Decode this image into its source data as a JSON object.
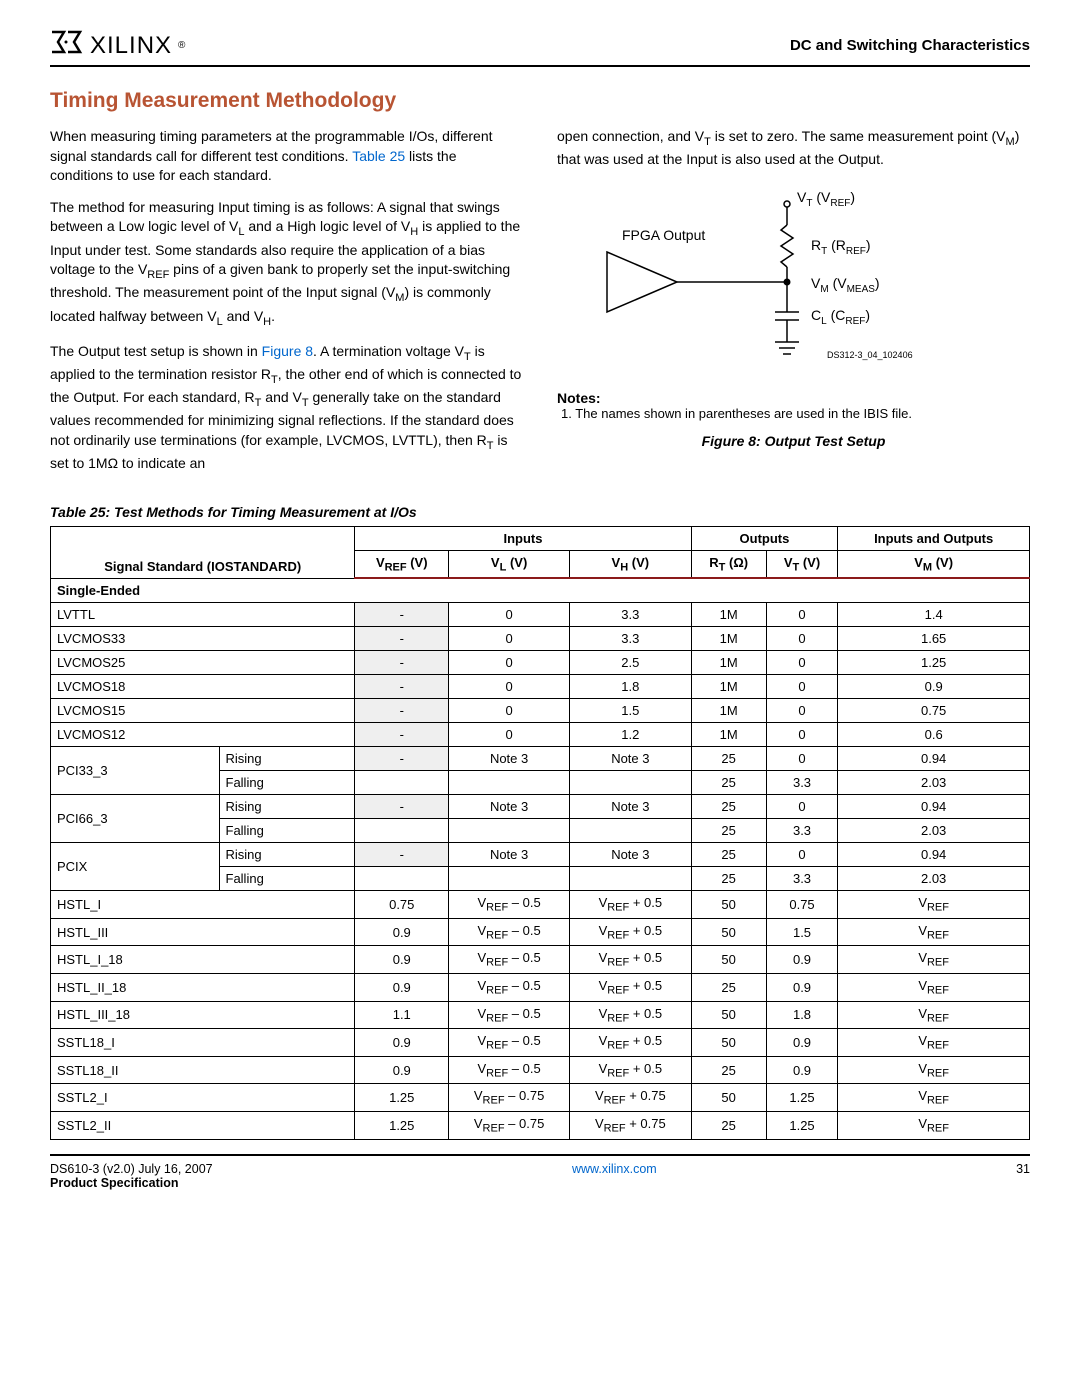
{
  "header": {
    "logo_text": "XILINX",
    "right": "DC and Switching Characteristics"
  },
  "title": "Timing Measurement Methodology",
  "para1": "When measuring timing parameters at the programmable I/Os, different signal standards call for different test conditions. |LINK| lists the conditions to use for each standard.",
  "para1_link": "Table 25",
  "para2": "The method for measuring Input timing is as follows: A signal that swings between a Low logic level of V|L| and a High logic level of V|H| is applied to the Input under test. Some standards also require the application of a bias voltage to the V|REF| pins of a given bank to properly set the input-switching threshold. The measurement point of the Input signal (V|M|) is commonly located halfway between V|L| and V|H|.",
  "para3": "The Output test setup is shown in |LINK|. A termination voltage V|T| is applied to the termination resistor R|T|, the other end of which is connected to the Output. For each standard, R|T| and V|T| generally take on the standard values recommended for minimizing signal reflections. If the standard does not ordinarily use terminations (for example, LVCMOS, LVTTL), then R|T| is set to 1MΩ  to indicate an",
  "para3_link": "Figure 8",
  "para4": "open connection, and V|T| is set to zero. The same measurement point (V|M|) that was used at the Input is also used at the Output.",
  "figure": {
    "fpga_output": "FPGA Output",
    "vt": "V|T| (V|REF|)",
    "rt": "R|T| (R|REF|)",
    "vm": "V|M| (V|MEAS|)",
    "cl": "C|L| (C|REF|)",
    "id": "DS312-3_04_102406",
    "notes_hdr": "Notes:",
    "note1": "1.  The names shown in parentheses are used in the IBIS file.",
    "caption": "Figure 8:  Output Test Setup"
  },
  "table": {
    "caption": "Table  25:  Test Methods for Timing Measurement at I/Os",
    "col_group": {
      "signal": "Signal Standard (IOSTANDARD)",
      "inputs": "Inputs",
      "outputs": "Outputs",
      "io": "Inputs and Outputs"
    },
    "cols": {
      "vref": "V|REF| (V)",
      "vl": "V|L| (V)",
      "vh": "V|H| (V)",
      "rt": "R|T| (Ω)",
      "vt": "V|T| (V)",
      "vm": "V|M| (V)"
    },
    "section": "Single-Ended",
    "rows": [
      {
        "std": "LVTTL",
        "vref": "-",
        "vl": "0",
        "vh": "3.3",
        "rt": "1M",
        "vt": "0",
        "vm": "1.4",
        "shade": true
      },
      {
        "std": "LVCMOS33",
        "vref": "-",
        "vl": "0",
        "vh": "3.3",
        "rt": "1M",
        "vt": "0",
        "vm": "1.65",
        "shade": true
      },
      {
        "std": "LVCMOS25",
        "vref": "-",
        "vl": "0",
        "vh": "2.5",
        "rt": "1M",
        "vt": "0",
        "vm": "1.25",
        "shade": true
      },
      {
        "std": "LVCMOS18",
        "vref": "-",
        "vl": "0",
        "vh": "1.8",
        "rt": "1M",
        "vt": "0",
        "vm": "0.9",
        "shade": true
      },
      {
        "std": "LVCMOS15",
        "vref": "-",
        "vl": "0",
        "vh": "1.5",
        "rt": "1M",
        "vt": "0",
        "vm": "0.75",
        "shade": true
      },
      {
        "std": "LVCMOS12",
        "vref": "-",
        "vl": "0",
        "vh": "1.2",
        "rt": "1M",
        "vt": "0",
        "vm": "0.6",
        "shade": true
      },
      {
        "std": "PCI33_3",
        "edge": "Rising",
        "vref": "-",
        "vl": "Note 3",
        "vh": "Note 3",
        "rt": "25",
        "vt": "0",
        "vm": "0.94",
        "shade": true,
        "span": 2
      },
      {
        "edge": "Falling",
        "rt": "25",
        "vt": "3.3",
        "vm": "2.03"
      },
      {
        "std": "PCI66_3",
        "edge": "Rising",
        "vref": "-",
        "vl": "Note 3",
        "vh": "Note 3",
        "rt": "25",
        "vt": "0",
        "vm": "0.94",
        "shade": true,
        "span": 2
      },
      {
        "edge": "Falling",
        "rt": "25",
        "vt": "3.3",
        "vm": "2.03"
      },
      {
        "std": "PCIX",
        "edge": "Rising",
        "vref": "-",
        "vl": "Note 3",
        "vh": "Note 3",
        "rt": "25",
        "vt": "0",
        "vm": "0.94",
        "shade": true,
        "span": 2
      },
      {
        "edge": "Falling",
        "rt": "25",
        "vt": "3.3",
        "vm": "2.03"
      },
      {
        "std": "HSTL_I",
        "vref": "0.75",
        "vl": "V|REF| – 0.5",
        "vh": "V|REF| + 0.5",
        "rt": "50",
        "vt": "0.75",
        "vm": "V|REF|"
      },
      {
        "std": "HSTL_III",
        "vref": "0.9",
        "vl": "V|REF| – 0.5",
        "vh": "V|REF| + 0.5",
        "rt": "50",
        "vt": "1.5",
        "vm": "V|REF|"
      },
      {
        "std": "HSTL_I_18",
        "vref": "0.9",
        "vl": "V|REF| – 0.5",
        "vh": "V|REF| + 0.5",
        "rt": "50",
        "vt": "0.9",
        "vm": "V|REF|"
      },
      {
        "std": "HSTL_II_18",
        "vref": "0.9",
        "vl": "V|REF| – 0.5",
        "vh": "V|REF| + 0.5",
        "rt": "25",
        "vt": "0.9",
        "vm": "V|REF|"
      },
      {
        "std": "HSTL_III_18",
        "vref": "1.1",
        "vl": "V|REF| – 0.5",
        "vh": "V|REF| + 0.5",
        "rt": "50",
        "vt": "1.8",
        "vm": "V|REF|"
      },
      {
        "std": "SSTL18_I",
        "vref": "0.9",
        "vl": "V|REF| – 0.5",
        "vh": "V|REF| + 0.5",
        "rt": "50",
        "vt": "0.9",
        "vm": "V|REF|"
      },
      {
        "std": "SSTL18_II",
        "vref": "0.9",
        "vl": "V|REF| – 0.5",
        "vh": "V|REF| + 0.5",
        "rt": "25",
        "vt": "0.9",
        "vm": "V|REF|"
      },
      {
        "std": "SSTL2_I",
        "vref": "1.25",
        "vl": "V|REF| – 0.75",
        "vh": "V|REF| + 0.75",
        "rt": "50",
        "vt": "1.25",
        "vm": "V|REF|"
      },
      {
        "std": "SSTL2_II",
        "vref": "1.25",
        "vl": "V|REF| – 0.75",
        "vh": "V|REF| + 0.75",
        "rt": "25",
        "vt": "1.25",
        "vm": "V|REF|"
      }
    ]
  },
  "footer": {
    "left1": "DS610-3 (v2.0) July 16, 2007",
    "left2": "Product Specification",
    "center": "www.xilinx.com",
    "right": "31"
  }
}
